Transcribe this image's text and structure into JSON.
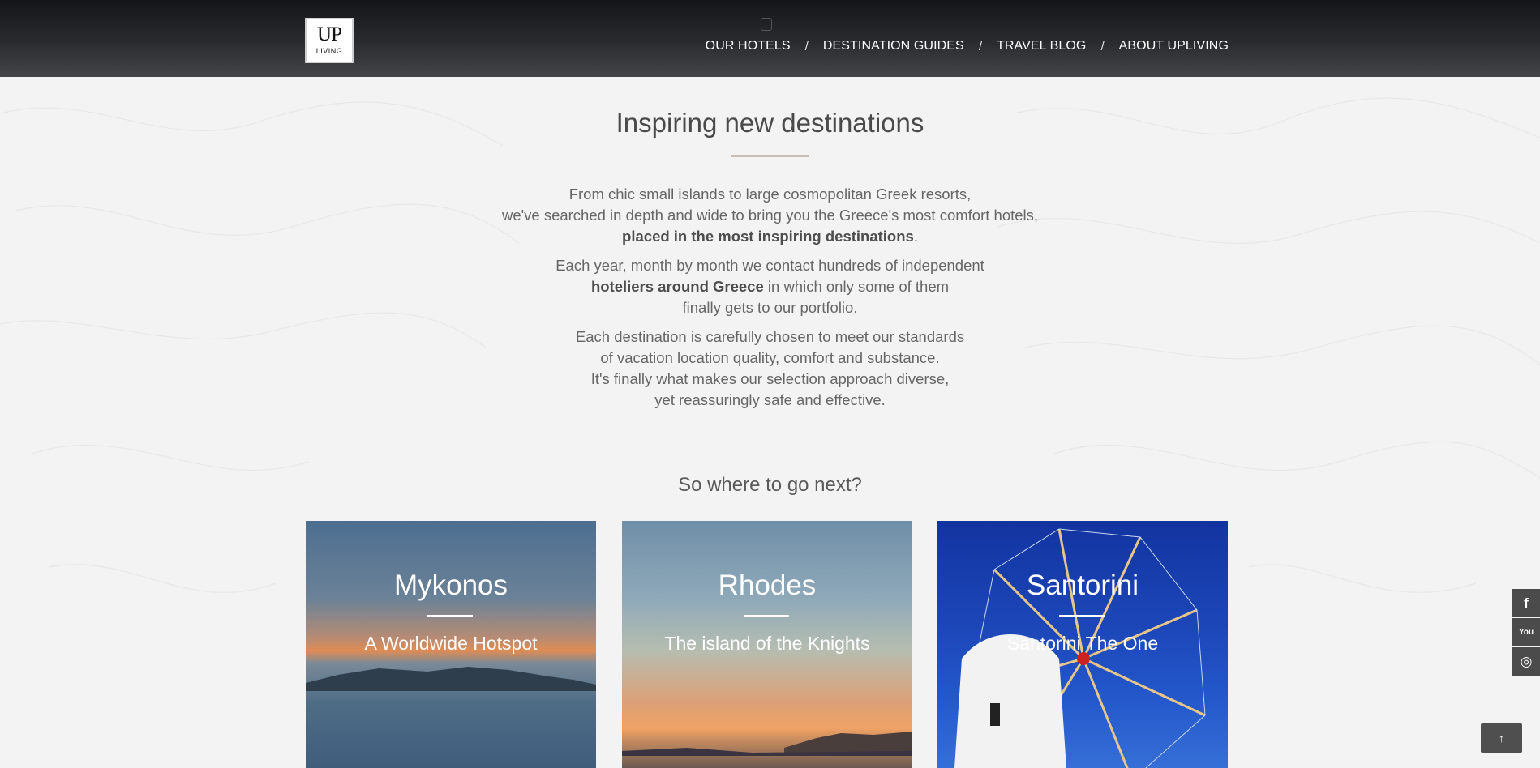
{
  "header": {
    "logo_top": "UP",
    "logo_bottom": "LIVING",
    "nav": [
      {
        "label": "OUR HOTELS"
      },
      {
        "label": "DESTINATION GUIDES"
      },
      {
        "label": "TRAVEL BLOG"
      },
      {
        "label": "ABOUT UPLIVING"
      }
    ],
    "separator": "/"
  },
  "intro": {
    "title": "Inspiring new destinations",
    "p1": {
      "l1": "From chic small islands to large cosmopolitan Greek resorts,",
      "l2": "we've searched in depth and wide to bring you the Greece's most comfort hotels,",
      "l3_bold": "placed in the most inspiring destinations",
      "l3_end": "."
    },
    "p2": {
      "l1": "Each year, month by month we contact hundreds of independent",
      "l2_bold": "hoteliers around Greece",
      "l2_rest": " in which only some of them",
      "l3": "finally gets to our portfolio."
    },
    "p3": {
      "l1": "Each destination is carefully chosen to meet our standards",
      "l2": "of vacation location quality, comfort and substance.",
      "l3": "It's finally what makes our selection approach diverse,",
      "l4": "yet reassuringly safe and effective."
    }
  },
  "next": {
    "heading": "So where to go next?",
    "cards": [
      {
        "title": "Mykonos",
        "subtitle": "A Worldwide Hotspot"
      },
      {
        "title": "Rhodes",
        "subtitle": "The island of the Knights"
      },
      {
        "title": "Santorini",
        "subtitle": "Santorini The One"
      }
    ]
  },
  "social": {
    "icons": [
      "facebook-icon",
      "youtube-icon",
      "instagram-icon"
    ],
    "facebook_glyph": "f",
    "youtube_glyph": "You",
    "instagram_glyph": "◎"
  },
  "back_to_top": "↑",
  "colors": {
    "header_dark": "#141518",
    "divider": "#c9bcb6",
    "social_bg": "#4b4b4b"
  }
}
